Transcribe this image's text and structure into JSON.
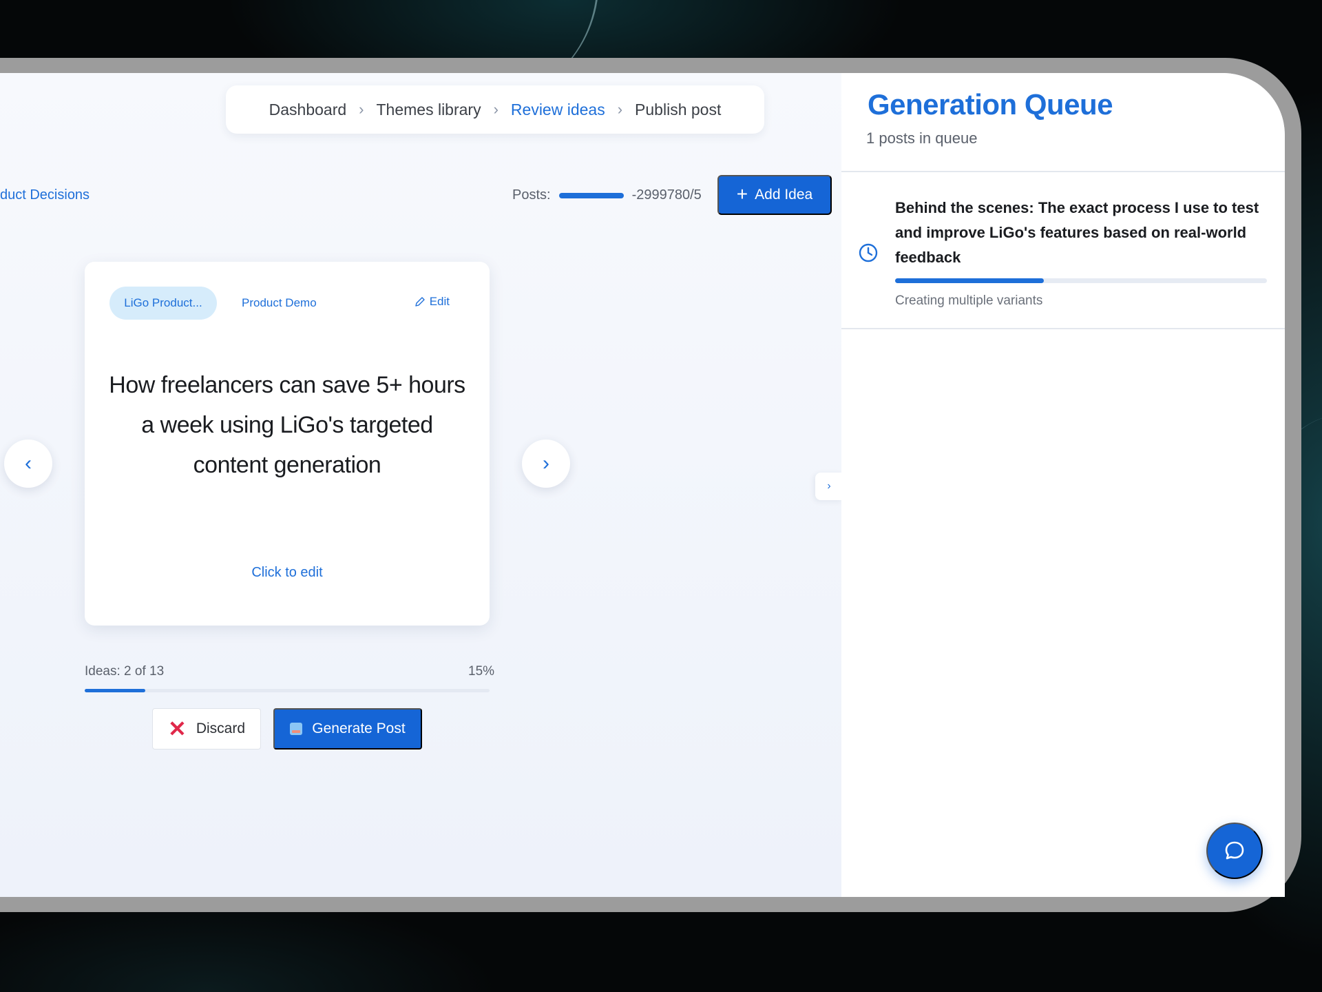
{
  "breadcrumb": {
    "items": [
      {
        "label": "Dashboard",
        "active": false
      },
      {
        "label": "Themes library",
        "active": false
      },
      {
        "label": "Review ideas",
        "active": true
      },
      {
        "label": "Publish post",
        "active": false
      }
    ],
    "separator": "›"
  },
  "toolbar": {
    "theme_link": "duct Decisions",
    "posts_label": "Posts:",
    "posts_count": "-2999780/5",
    "add_idea_label": "Add Idea",
    "add_icon": "+"
  },
  "idea_card": {
    "tag_primary": "LiGo Product...",
    "tag_secondary": "Product Demo",
    "edit_label": "Edit",
    "title": "How freelancers can save 5+ hours a week using LiGo's targeted content generation",
    "click_to_edit": "Click to edit",
    "discard_label": "Discard",
    "generate_label": "Generate Post"
  },
  "carousel": {
    "prev_icon": "‹",
    "next_icon": "›"
  },
  "progress": {
    "label": "Ideas: 2 of 13",
    "percent_label": "15%",
    "fraction": 0.15
  },
  "queue": {
    "title": "Generation Queue",
    "subtitle": "1 posts in queue",
    "items": [
      {
        "title": "Behind the scenes: The exact process I use to test and improve LiGo's features based on real-world feedback",
        "status": "Creating multiple variants",
        "progress": 0.4
      }
    ],
    "collapse_icon": "›"
  },
  "colors": {
    "accent": "#1e6fd9",
    "button": "#1565d6",
    "danger": "#e0284a"
  },
  "icons": {
    "edit": "pencil-icon",
    "queue_item": "clock-icon",
    "chat": "chat-bubble-icon",
    "discard": "close-icon",
    "generate": "robot-icon"
  }
}
